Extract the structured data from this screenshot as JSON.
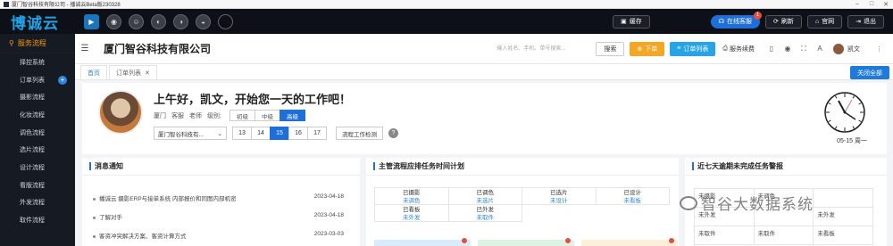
{
  "window": {
    "title": "厦门智谷科技有限公司 - 播诚云Beta版230328"
  },
  "topbar": {
    "logo": "博诚云",
    "buttons": {
      "chat": "在线客服",
      "refresh": "刷新",
      "website": "官网",
      "exit": "退出",
      "cache": "缓存",
      "chat_badge": "1"
    }
  },
  "sidebar": {
    "header": "服务流程",
    "items": [
      "择控系统",
      "订单列表",
      "摄影流程",
      "化妆流程",
      "调色流程",
      "选片流程",
      "设计流程",
      "看版流程",
      "外发流程",
      "取件流程"
    ]
  },
  "header": {
    "company": "厦门智谷科技有限公司",
    "search_placeholder": "输入姓名、手机、单号搜索...",
    "search_btn": "搜索",
    "order_btn": "下单",
    "order_list_btn": "订单列表",
    "service_fee": "服务续费",
    "username": "凯文"
  },
  "tabs": {
    "home": "首页",
    "order_list": "订单列表",
    "close_all": "关闭全部"
  },
  "welcome": {
    "greeting": "上午好，凯文，开始您一天的工作吧！",
    "company_short": "厦门",
    "role_prefix": "客服",
    "role": "老师",
    "level_label": "级别:",
    "levels": [
      "初级",
      "中级",
      "高级"
    ],
    "company_select": "厦门智谷科技有...",
    "days": [
      "13",
      "14",
      "15",
      "16",
      "17"
    ],
    "check_btn": "流程工作检测",
    "date": "05-15 周一"
  },
  "news": {
    "title": "消息通知",
    "items": [
      {
        "text": "播诚云 摄影ERP与接单系统 内部报价和同图内部机密",
        "date": "2023-04-18"
      },
      {
        "text": "了解对手",
        "date": "2023-04-18"
      },
      {
        "text": "客资冲突解决方案、客资计算方式",
        "date": "2023-03-03"
      }
    ]
  },
  "schedule": {
    "title": "主管流程应排任务时间计划",
    "cells": [
      {
        "label": "已摄影",
        "value": "未调色"
      },
      {
        "label": "已调色",
        "value": "未选片"
      },
      {
        "label": "已选片",
        "value": "未设计"
      },
      {
        "label": "已设计",
        "value": "未看板"
      },
      {
        "label": "已看板",
        "value": "未外发"
      },
      {
        "label": "已外发",
        "value": "未取件"
      }
    ],
    "card_colors": [
      "#d9ecfb",
      "#dff3e4",
      "#fdf0d8"
    ]
  },
  "warning": {
    "title": "近七天逾期未完成任务警报",
    "cells": [
      "未摄影",
      "未调色",
      "",
      "未外发",
      "",
      "未外发",
      "未取件",
      "未取件",
      "未看板"
    ]
  },
  "watermark": "智谷大数据系统"
}
